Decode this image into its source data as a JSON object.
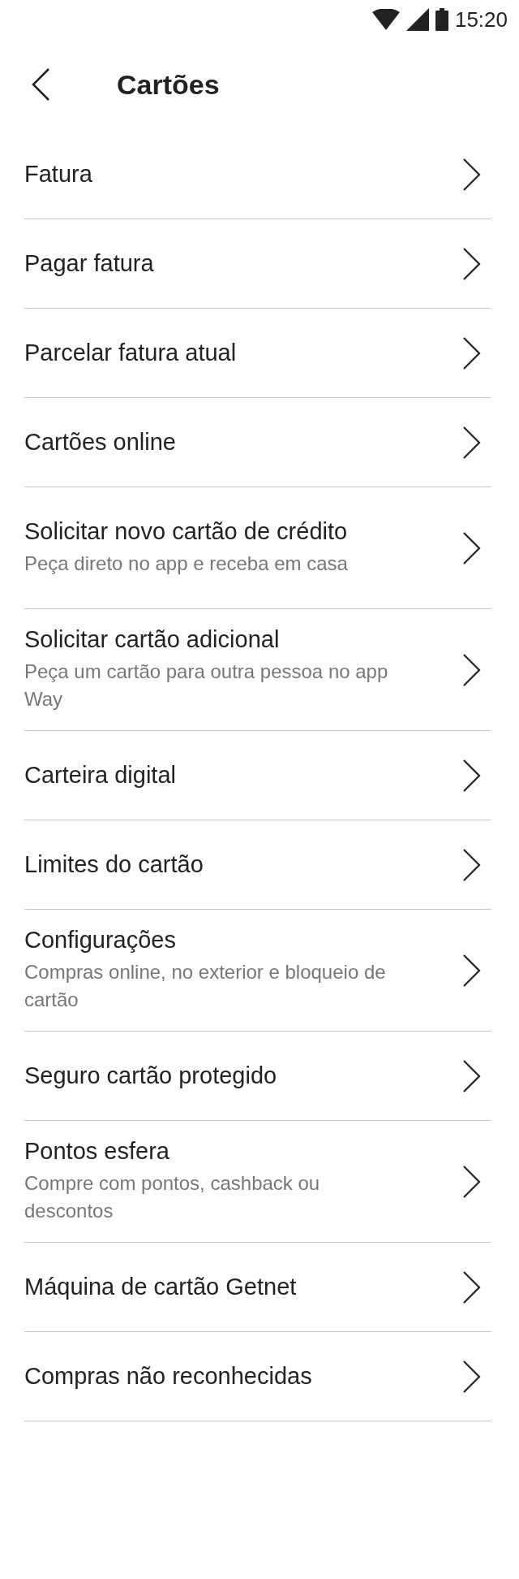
{
  "status_bar": {
    "time": "15:20"
  },
  "header": {
    "title": "Cartões"
  },
  "items": [
    {
      "title": "Fatura"
    },
    {
      "title": "Pagar fatura"
    },
    {
      "title": "Parcelar fatura atual"
    },
    {
      "title": "Cartões online"
    },
    {
      "title": "Solicitar novo cartão de crédito",
      "subtitle": "Peça direto no app e receba em casa"
    },
    {
      "title": "Solicitar cartão adicional",
      "subtitle": "Peça um cartão para outra pessoa no app Way"
    },
    {
      "title": "Carteira digital"
    },
    {
      "title": "Limites do cartão"
    },
    {
      "title": "Configurações",
      "subtitle": "Compras online, no exterior e bloqueio de cartão"
    },
    {
      "title": "Seguro cartão protegido"
    },
    {
      "title": "Pontos esfera",
      "subtitle": "Compre com pontos, cashback ou descontos"
    },
    {
      "title": "Máquina de cartão Getnet"
    },
    {
      "title": "Compras não reconhecidas"
    }
  ]
}
